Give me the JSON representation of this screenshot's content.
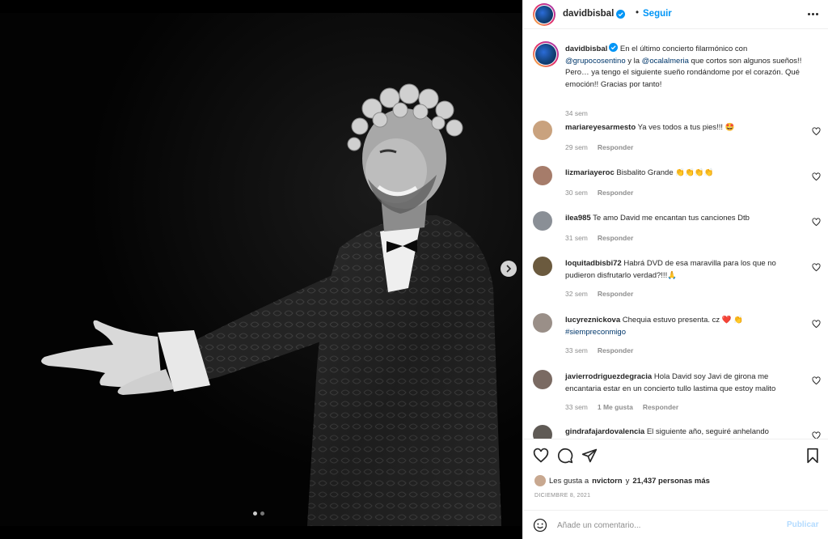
{
  "media": {
    "carousel": {
      "total": 2,
      "active_index": 0
    },
    "next_icon": "chevron-right-icon"
  },
  "header": {
    "username": "davidbisbal",
    "separator": "•",
    "follow_label": "Seguir",
    "more_icon": "more-horizontal-icon"
  },
  "caption": {
    "username": "davidbisbal",
    "text_1": " En el último concierto filarmónico con ",
    "mention_1": "@grupocosentino",
    "text_2": " y la ",
    "mention_2": "@ocalalmeria",
    "text_3": " que cortos son algunos sueños!! Pero… ya tengo el siguiente sueño rondándome por el corazón. Qué emoción!! Gracias por tanto!",
    "time": "34 sem"
  },
  "comments": [
    {
      "username": "mariareyesarmesto",
      "text": " Ya ves todos a tus pies!!! 🤩",
      "time": "29 sem",
      "reply": "Responder",
      "avatar_color": "#c9a27e"
    },
    {
      "username": "lizmariayeroc",
      "text": " Bisbalito Grande 👏👏👏👏",
      "time": "30 sem",
      "reply": "Responder",
      "avatar_color": "#a67c6a"
    },
    {
      "username": "ilea985",
      "text": " Te amo David me encantan tus canciones Dtb",
      "time": "31 sem",
      "reply": "Responder",
      "avatar_color": "#8a8f96"
    },
    {
      "username": "loquitadbisbi72",
      "text": " Habrá DVD de esa maravilla para los que no pudieron disfrutarlo verdad?!!!🙏",
      "time": "32 sem",
      "reply": "Responder",
      "avatar_color": "#6b5a3e"
    },
    {
      "username": "lucyreznickova",
      "text": " Chequia estuvo presenta. cz ❤️ 👏",
      "hashtag": "#siempreconmigo",
      "time": "33 sem",
      "reply": "Responder",
      "avatar_color": "#9a8f88"
    },
    {
      "username": "javierrodriguezdegracia",
      "text": " Hola David soy Javi de girona me encantaria estar en un concierto tullo lastima que estoy malito",
      "time": "33 sem",
      "likes": "1 Me gusta",
      "reply": "Responder",
      "avatar_color": "#7a6a62"
    },
    {
      "username": "gindrafajardovalencia",
      "text": " El siguiente año, seguiré anhelando",
      "time": "",
      "reply": "",
      "avatar_color": "#5f5a55"
    }
  ],
  "actions": {
    "like_icon": "heart-icon",
    "comment_icon": "comment-icon",
    "share_icon": "send-icon",
    "save_icon": "bookmark-icon",
    "likes_prefix": "Les gusta a",
    "likes_user": "nvictorn",
    "likes_and": "y",
    "likes_count": "21,437 personas más",
    "date": "DICIEMBRE 8, 2021"
  },
  "add_comment": {
    "emoji_icon": "emoji-icon",
    "placeholder": "Añade un comentario...",
    "publish_label": "Publicar"
  },
  "colors": {
    "accent": "#0095f6",
    "mention": "#00376b",
    "muted": "#8e8e8e",
    "publish_disabled": "#b3dbff"
  }
}
